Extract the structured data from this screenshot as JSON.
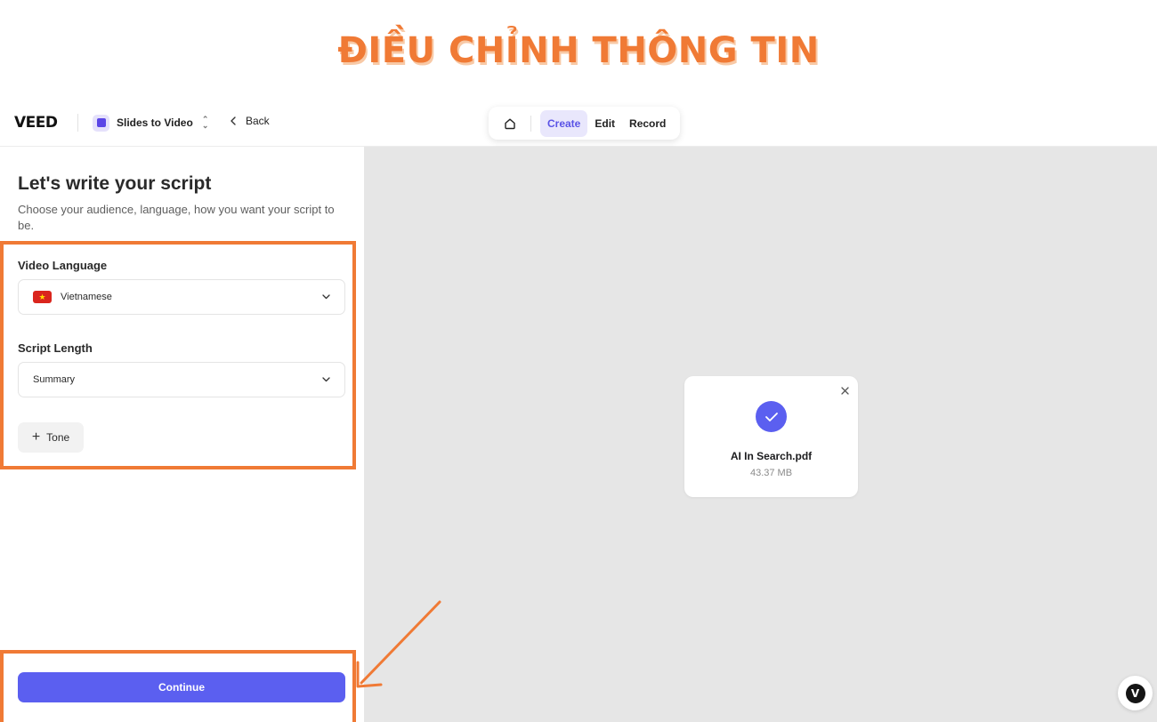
{
  "banner": {
    "title": "ĐIỀU CHỈNH THÔNG TIN"
  },
  "topbar": {
    "logo": "VEED",
    "project_name": "Slides to Video",
    "back_label": "Back",
    "modes": [
      {
        "label": "Create",
        "active": true
      },
      {
        "label": "Edit",
        "active": false
      },
      {
        "label": "Record",
        "active": false
      }
    ]
  },
  "panel": {
    "title": "Let's write your script",
    "subtitle": "Choose your audience, language, how you want your script to be.",
    "language": {
      "label": "Video Language",
      "value": "Vietnamese"
    },
    "script_length": {
      "label": "Script Length",
      "value": "Summary"
    },
    "tone_label": "Tone",
    "continue_label": "Continue"
  },
  "file": {
    "name": "AI In Search.pdf",
    "size": "43.37 MB"
  },
  "help": {
    "glyph": "V"
  },
  "colors": {
    "accent": "#5b5ff0",
    "annotation": "#f07a35",
    "preview_bg": "#e6e6e6"
  }
}
